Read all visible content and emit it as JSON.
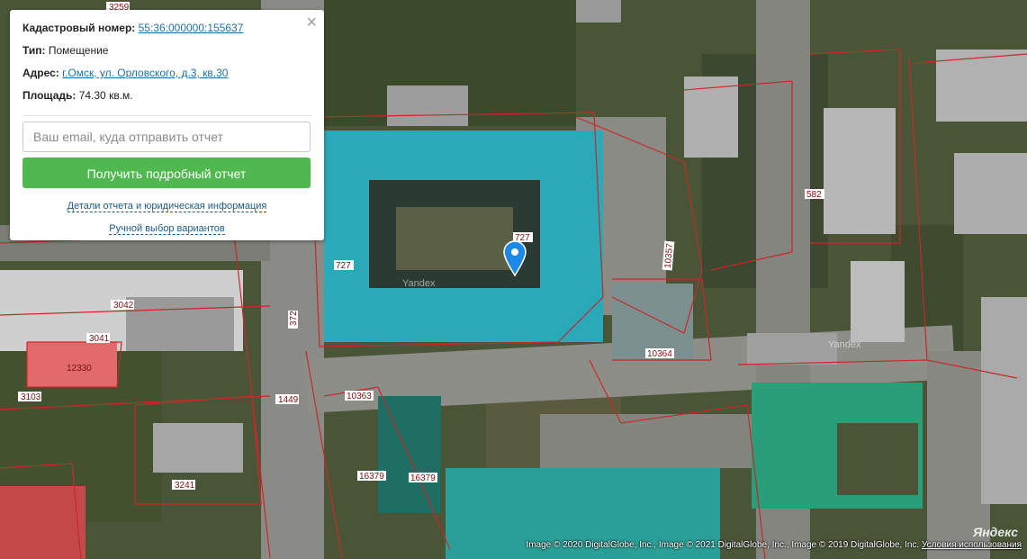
{
  "popup": {
    "cadastral_label": "Кадастровый номер:",
    "cadastral_value": "55:36:000000:155637",
    "type_label": "Тип:",
    "type_value": "Помещение",
    "address_label": "Адрес:",
    "address_value": "г.Омск, ул. Орловского, д.3, кв.30",
    "area_label": "Площадь:",
    "area_value": "74.30 кв.м.",
    "email_placeholder": "Ваш email, куда отправить отчет",
    "report_button": "Получить подробный отчет",
    "details_link": "Детали отчета и юридическая информация",
    "manual_link": "Ручной выбор вариантов",
    "close_icon": "close-icon"
  },
  "map": {
    "parcel_labels": [
      "3259",
      "3042",
      "3041",
      "12330",
      "3103",
      "1449",
      "372",
      "727",
      "727",
      "10357",
      "582",
      "10364",
      "10363",
      "16379",
      "16379",
      "3241"
    ],
    "watermarks": [
      "Yandex",
      "Yandex"
    ],
    "marker_icon": "map-pin-icon",
    "logo": "Яндекс",
    "attribution": "Image © 2020 DigitalGlobe, Inc., Image © 2021 DigitalGlobe, Inc., Image © 2019 DigitalGlobe, Inc.",
    "terms_link": "Условия использования",
    "colors": {
      "highlight": "#2aa9b8",
      "parcel_border": "#c8282a",
      "button": "#4fb84f"
    }
  }
}
